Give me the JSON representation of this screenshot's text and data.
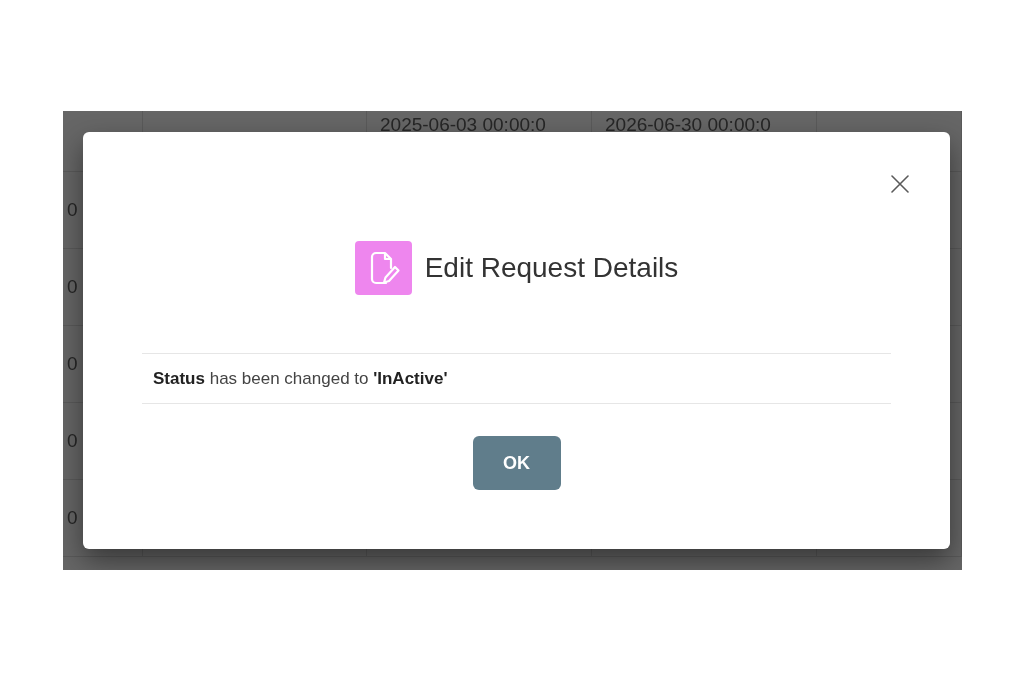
{
  "background_table": {
    "rows": [
      {
        "column_3": "2025-06-03 00:00:0",
        "column_4": "2026-06-30 00:00:0"
      },
      {
        "column_1": "0"
      },
      {
        "column_1": "0"
      },
      {
        "column_1": "0"
      },
      {
        "column_1": "0"
      },
      {
        "column_1": "0"
      }
    ]
  },
  "dialog": {
    "title": "Edit Request Details",
    "message": "**Status** has been changed to **'InActive'**",
    "buttons": [
      {
        "label": "OK"
      }
    ]
  }
}
